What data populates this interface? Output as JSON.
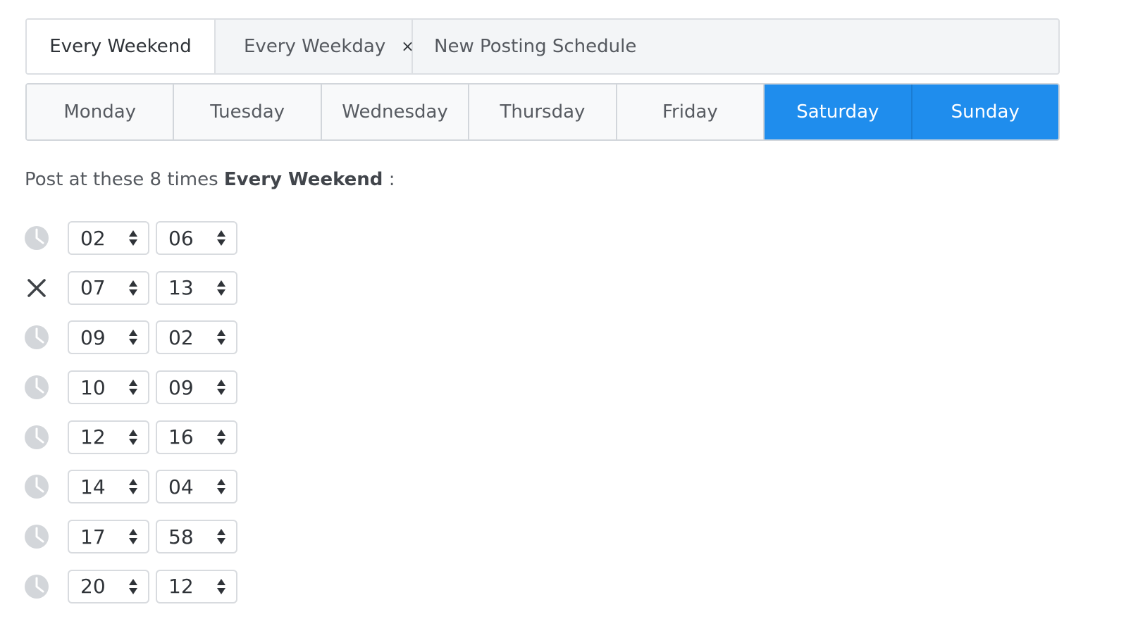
{
  "tabs": {
    "active": "Every Weekend",
    "weekday": "Every Weekday",
    "weekday_close": "×",
    "new": "New Posting Schedule"
  },
  "days": [
    {
      "label": "Monday",
      "selected": false
    },
    {
      "label": "Tuesday",
      "selected": false
    },
    {
      "label": "Wednesday",
      "selected": false
    },
    {
      "label": "Thursday",
      "selected": false
    },
    {
      "label": "Friday",
      "selected": false
    },
    {
      "label": "Saturday",
      "selected": true
    },
    {
      "label": "Sunday",
      "selected": true
    }
  ],
  "heading": {
    "prefix": "Post at these 8 times",
    "schedule_name": "Every Weekend",
    "suffix": ":"
  },
  "times": [
    {
      "hour": "02",
      "minute": "06",
      "icon": "clock-icon"
    },
    {
      "hour": "07",
      "minute": "13",
      "icon": "remove-icon"
    },
    {
      "hour": "09",
      "minute": "02",
      "icon": "clock-icon"
    },
    {
      "hour": "10",
      "minute": "09",
      "icon": "clock-icon"
    },
    {
      "hour": "12",
      "minute": "16",
      "icon": "clock-icon"
    },
    {
      "hour": "14",
      "minute": "04",
      "icon": "clock-icon"
    },
    {
      "hour": "17",
      "minute": "58",
      "icon": "clock-icon"
    },
    {
      "hour": "20",
      "minute": "12",
      "icon": "clock-icon"
    }
  ],
  "colors": {
    "accent": "#1f8ded",
    "tab_bar_bg": "#f3f5f7",
    "day_bg": "#f8f9fa",
    "clock_icon": "#d3d6da",
    "text": "#4a4e55"
  }
}
